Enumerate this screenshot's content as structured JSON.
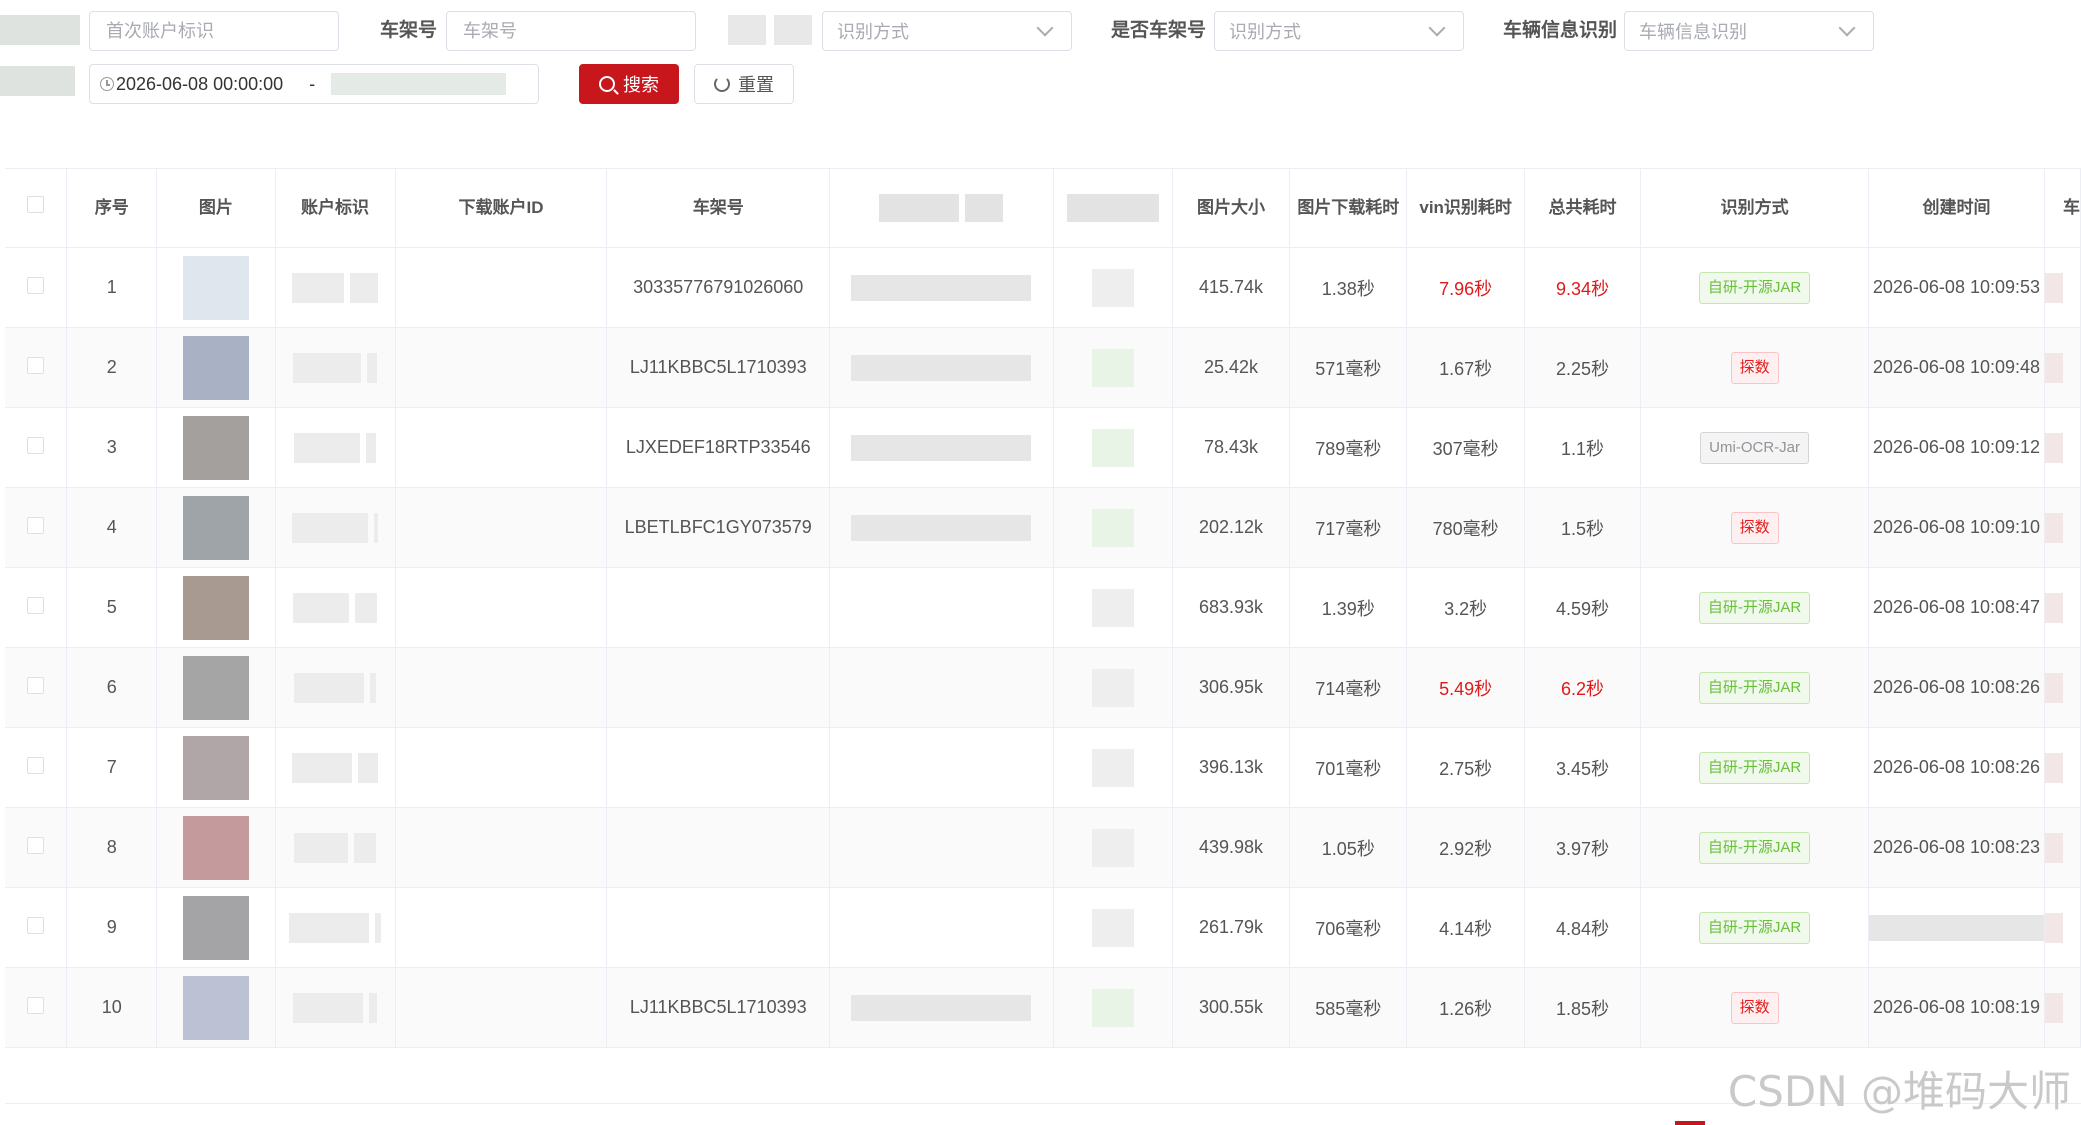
{
  "filters": {
    "account_placeholder": "首次账户标识",
    "vin_label": "车架号",
    "vin_placeholder": "车架号",
    "method_placeholder": "识别方式",
    "is_vin_label": "是否车架号",
    "is_vin_placeholder": "识别方式",
    "vehicle_info_label": "车辆信息识别",
    "vehicle_info_placeholder": "车辆信息识别",
    "date_start": "2026-06-08 00:00:00",
    "date_separator": "-",
    "search_button": "搜索",
    "reset_button": "重置"
  },
  "table": {
    "headers": {
      "index": "序号",
      "image": "图片",
      "account": "账户标识",
      "download_account": "下载账户ID",
      "vin": "车架号",
      "size": "图片大小",
      "download_time": "图片下载耗时",
      "vin_time": "vin识别耗时",
      "total_time": "总共耗时",
      "method": "识别方式",
      "created": "创建时间",
      "extra": "车"
    },
    "rows": [
      {
        "index": "1",
        "vin": "30335776791026060",
        "size": "415.74k",
        "download_time": "1.38秒",
        "vin_time": "7.96秒",
        "total_time": "9.34秒",
        "method": "自研-开源JAR",
        "created": "2026-06-08 10:09:53",
        "vin_red": true,
        "total_red": true,
        "tag": "green",
        "thumb": "#dfe6ee"
      },
      {
        "index": "2",
        "vin": "LJ11KBBC5L1710393",
        "size": "25.42k",
        "download_time": "571毫秒",
        "vin_time": "1.67秒",
        "total_time": "2.25秒",
        "method": "探数",
        "created": "2026-06-08 10:09:48",
        "vin_red": false,
        "total_red": false,
        "tag": "red",
        "thumb": "#a9b1c4"
      },
      {
        "index": "3",
        "vin": "LJXEDEF18RTP33546",
        "size": "78.43k",
        "download_time": "789毫秒",
        "vin_time": "307毫秒",
        "total_time": "1.1秒",
        "method": "Umi-OCR-Jar",
        "created": "2026-06-08 10:09:12",
        "vin_red": false,
        "total_red": false,
        "tag": "gray",
        "thumb": "#a3a09e"
      },
      {
        "index": "4",
        "vin": "LBETLBFC1GY073579",
        "size": "202.12k",
        "download_time": "717毫秒",
        "vin_time": "780毫秒",
        "total_time": "1.5秒",
        "method": "探数",
        "created": "2026-06-08 10:09:10",
        "vin_red": false,
        "total_red": false,
        "tag": "red",
        "thumb": "#9ea4a8"
      },
      {
        "index": "5",
        "vin": "",
        "size": "683.93k",
        "download_time": "1.39秒",
        "vin_time": "3.2秒",
        "total_time": "4.59秒",
        "method": "自研-开源JAR",
        "created": "2026-06-08 10:08:47",
        "vin_red": false,
        "total_red": false,
        "tag": "green",
        "thumb": "#a89a90"
      },
      {
        "index": "6",
        "vin": "",
        "size": "306.95k",
        "download_time": "714毫秒",
        "vin_time": "5.49秒",
        "total_time": "6.2秒",
        "method": "自研-开源JAR",
        "created": "2026-06-08 10:08:26",
        "vin_red": true,
        "total_red": true,
        "tag": "green",
        "thumb": "#a5a5a5"
      },
      {
        "index": "7",
        "vin": "",
        "size": "396.13k",
        "download_time": "701毫秒",
        "vin_time": "2.75秒",
        "total_time": "3.45秒",
        "method": "自研-开源JAR",
        "created": "2026-06-08 10:08:26",
        "vin_red": false,
        "total_red": false,
        "tag": "green",
        "thumb": "#b0a6a8"
      },
      {
        "index": "8",
        "vin": "",
        "size": "439.98k",
        "download_time": "1.05秒",
        "vin_time": "2.92秒",
        "total_time": "3.97秒",
        "method": "自研-开源JAR",
        "created": "2026-06-08 10:08:23",
        "vin_red": false,
        "total_red": false,
        "tag": "green",
        "thumb": "#c49a9c"
      },
      {
        "index": "9",
        "vin": "",
        "size": "261.79k",
        "download_time": "706毫秒",
        "vin_time": "4.14秒",
        "total_time": "4.84秒",
        "method": "自研-开源JAR",
        "created": "",
        "vin_red": false,
        "total_red": false,
        "tag": "green",
        "thumb": "#a4a4a6"
      },
      {
        "index": "10",
        "vin": "LJ11KBBC5L1710393",
        "size": "300.55k",
        "download_time": "585毫秒",
        "vin_time": "1.26秒",
        "total_time": "1.85秒",
        "method": "探数",
        "created": "2026-06-08 10:08:19",
        "vin_red": false,
        "total_red": false,
        "tag": "red",
        "thumb": "#bcc2d4"
      }
    ]
  },
  "watermark": "CSDN @堆码大师"
}
